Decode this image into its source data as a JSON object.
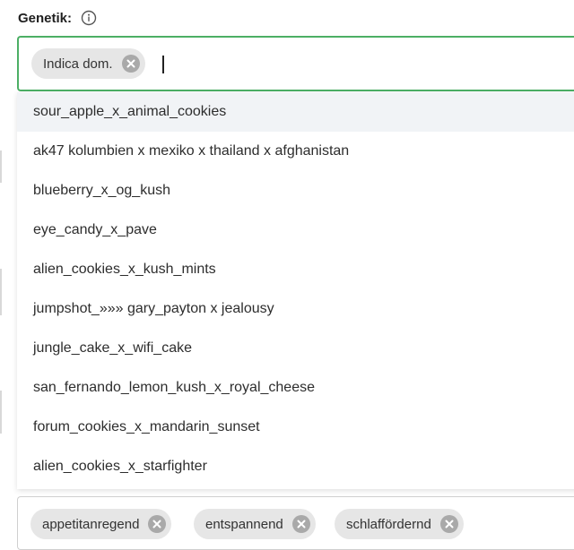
{
  "field": {
    "label": "Genetik:",
    "info_icon": "info-icon"
  },
  "select": {
    "chips": [
      {
        "label": "Indica dom.",
        "remove_icon": "close-circle-icon"
      }
    ],
    "input_value": ""
  },
  "dropdown": {
    "options": [
      {
        "label": "sour_apple_x_animal_cookies",
        "highlighted": true
      },
      {
        "label": "ak47 kolumbien x mexiko x thailand x afghanistan",
        "highlighted": false
      },
      {
        "label": "blueberry_x_og_kush",
        "highlighted": false
      },
      {
        "label": "eye_candy_x_pave",
        "highlighted": false
      },
      {
        "label": "alien_cookies_x_kush_mints",
        "highlighted": false
      },
      {
        "label": "jumpshot_»»» gary_payton x jealousy",
        "highlighted": false
      },
      {
        "label": "jungle_cake_x_wifi_cake",
        "highlighted": false
      },
      {
        "label": "san_fernando_lemon_kush_x_royal_cheese",
        "highlighted": false
      },
      {
        "label": "forum_cookies_x_mandarin_sunset",
        "highlighted": false
      },
      {
        "label": "alien_cookies_x_starfighter",
        "highlighted": false
      }
    ]
  },
  "next_select": {
    "chips": [
      {
        "label": "appetitanregend",
        "remove_icon": "close-circle-icon"
      },
      {
        "label": "entspannend",
        "remove_icon": "close-circle-icon"
      },
      {
        "label": "schlaffördernd",
        "remove_icon": "close-circle-icon"
      }
    ]
  },
  "colors": {
    "focus_border": "#4caf65",
    "chip_bg": "#e6e6e6",
    "highlight_bg": "#f1f3f6"
  }
}
